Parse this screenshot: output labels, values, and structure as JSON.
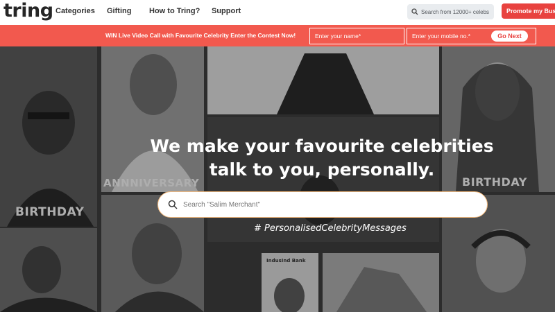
{
  "nav": {
    "logo": "tring",
    "links": [
      "Categories",
      "Gifting",
      "How to Tring?",
      "Support"
    ],
    "search_placeholder": "Search from 12000+ celebs",
    "promote_label": "Promote my Bus"
  },
  "banner": {
    "text": "WIN Live Video Call with Favourite Celebrity Enter the Contest Now!",
    "name_placeholder": "Enter your name*",
    "mobile_placeholder": "Enter your mobile no.*",
    "go_next_label": "Go Next"
  },
  "hero": {
    "headline_line1": "We make your favourite celebrities",
    "headline_line2": "talk to you, personally.",
    "search_placeholder": "Search \"Salim Merchant\"",
    "hashtag": "# PersonalisedCelebrityMessages",
    "tiles": {
      "anniversary": "ANNNIVERSARY",
      "birthday_left": "BIRTHDAY",
      "birthday_right": "BIRTHDAY",
      "bank_sign": "IndusInd Bank"
    }
  },
  "colors": {
    "brand_red": "#e8423f",
    "banner_red": "#f2594e",
    "search_border": "#f3b97c"
  }
}
